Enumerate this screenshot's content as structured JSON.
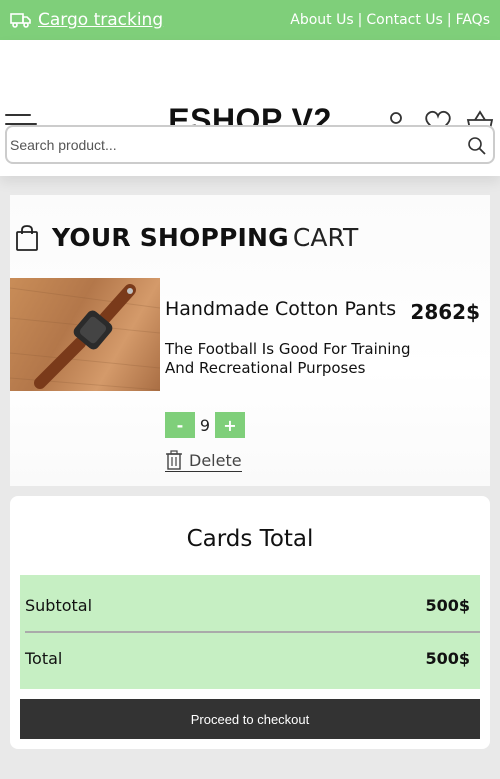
{
  "topbar": {
    "tracking_label": "Cargo tracking",
    "links": [
      "About Us",
      "Contact Us",
      "FAQs"
    ],
    "separator": "|",
    "color": "#7fcf7a"
  },
  "header": {
    "brand": "ESHOP V2",
    "icons": [
      "menu-icon",
      "user-icon",
      "heart-icon",
      "basket-icon"
    ]
  },
  "search": {
    "placeholder": "Search product..."
  },
  "cart": {
    "title_strong": "YOUR SHOPPING",
    "title_light": "CART",
    "item": {
      "name": "Handmade Cotton Pants",
      "price": "2862$",
      "description": "The Football Is Good For Training And Recreational Purposes",
      "quantity": "9",
      "minus_label": "-",
      "plus_label": "+",
      "delete_label": "Delete"
    }
  },
  "totals": {
    "title": "Cards Total",
    "subtotal_label": "Subtotal",
    "subtotal_value": "500$",
    "total_label": "Total",
    "total_value": "500$",
    "checkout_label": "Proceed to checkout",
    "box_color": "#c6efc3"
  }
}
